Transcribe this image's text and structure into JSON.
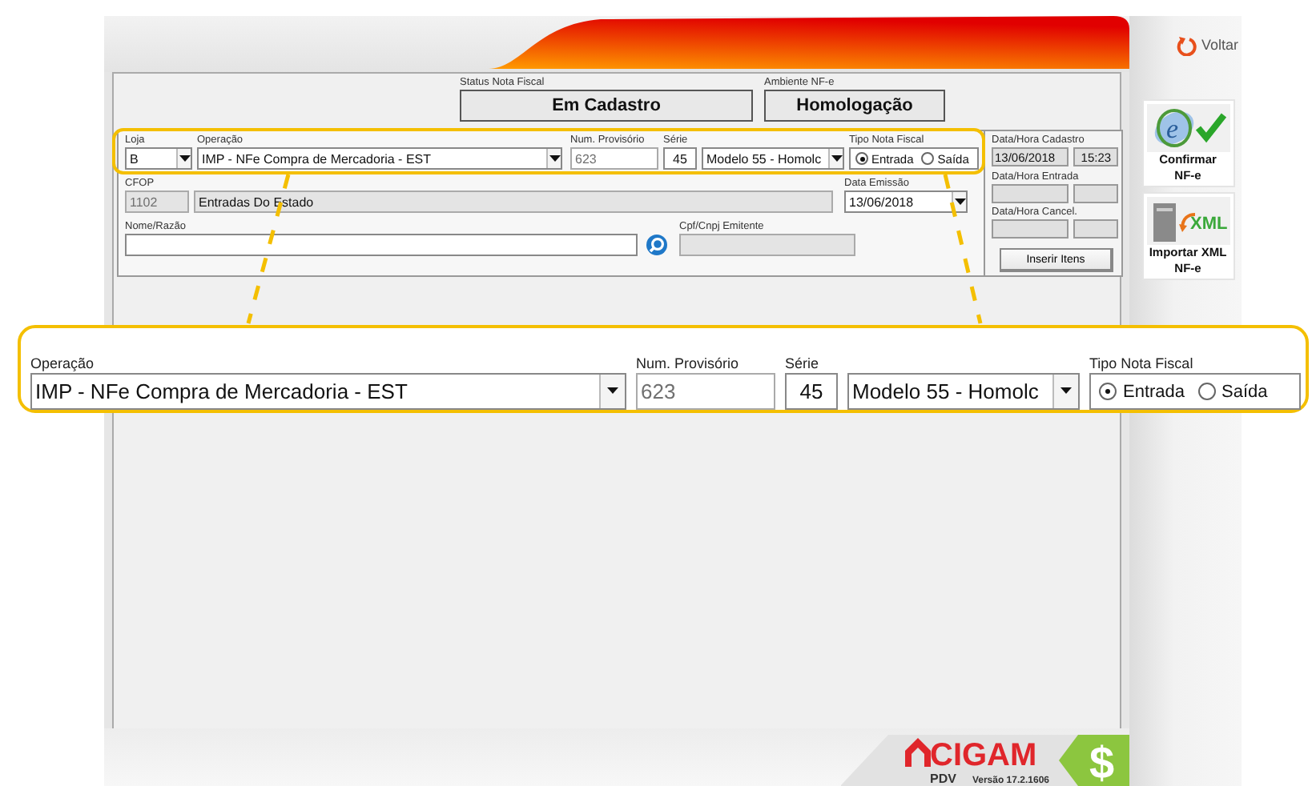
{
  "header": {
    "status": {
      "label": "Status Nota Fiscal",
      "value": "Em Cadastro"
    },
    "ambiente": {
      "label": "Ambiente NF-e",
      "value": "Homologação"
    }
  },
  "form": {
    "loja": {
      "label": "Loja",
      "value": "B"
    },
    "operacao": {
      "label": "Operação",
      "value": "IMP - NFe Compra de Mercadoria - EST"
    },
    "num_provisorio": {
      "label": "Num. Provisório",
      "value": "623"
    },
    "serie": {
      "label": "Série",
      "value": "45"
    },
    "modelo": {
      "value": "Modelo 55 - Homolc"
    },
    "tipo_nota": {
      "label": "Tipo Nota Fiscal",
      "options": [
        {
          "label": "Entrada",
          "selected": true
        },
        {
          "label": "Saída",
          "selected": false
        }
      ]
    },
    "cfop": {
      "label": "CFOP",
      "code": "1102",
      "description": "Entradas Do Estado"
    },
    "data_emissao": {
      "label": "Data Emissão",
      "value": "13/06/2018"
    },
    "nome_razao": {
      "label": "Nome/Razão"
    },
    "cpf_cnpj": {
      "label": "Cpf/Cnpj Emitente"
    }
  },
  "dates": {
    "cadastro": {
      "label": "Data/Hora Cadastro",
      "date": "13/06/2018",
      "time": "15:23"
    },
    "entrada": {
      "label": "Data/Hora Entrada"
    },
    "cancel": {
      "label": "Data/Hora Cancel."
    },
    "insert_button": "Inserir Itens"
  },
  "callout": {
    "operacao": {
      "label": "Operação",
      "value": "IMP - NFe Compra de Mercadoria - EST"
    },
    "num_provisorio": {
      "label": "Num. Provisório",
      "value": "623"
    },
    "serie": {
      "label": "Série",
      "value": "45"
    },
    "modelo": {
      "value": "Modelo 55 - Homolc"
    },
    "tipo_nota": {
      "label": "Tipo Nota Fiscal",
      "options": [
        {
          "label": "Entrada",
          "selected": true
        },
        {
          "label": "Saída",
          "selected": false
        }
      ]
    }
  },
  "sidebar": {
    "back": "Voltar",
    "actions": [
      {
        "kind": "confirm",
        "icon_text": "e",
        "label": "Confirmar NF-e"
      },
      {
        "kind": "import",
        "icon_text": "XML",
        "label": "Importar XML NF-e"
      }
    ]
  },
  "footer": {
    "brand": "CIGAM",
    "product": "PDV",
    "version": "Versão 17.2.1606",
    "symbol": "$"
  }
}
